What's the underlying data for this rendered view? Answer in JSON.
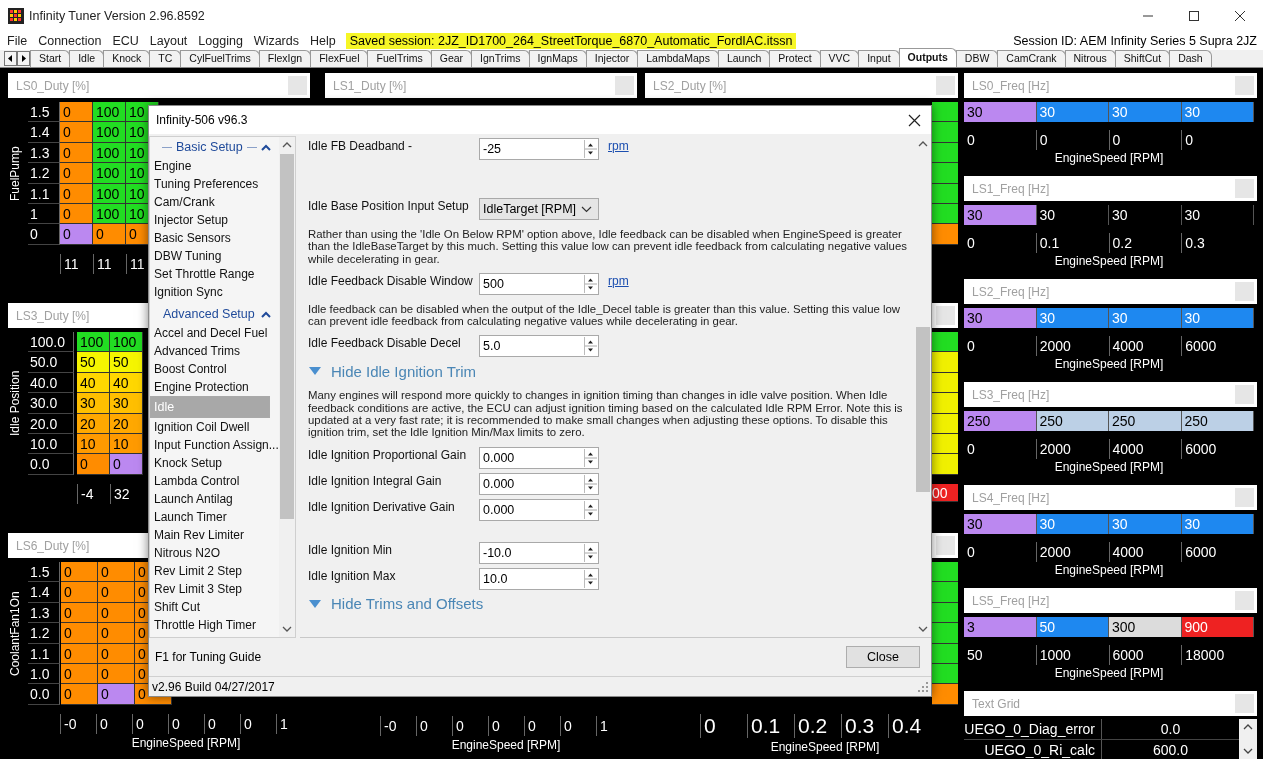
{
  "window": {
    "title": "Infinity Tuner Version 2.96.8592"
  },
  "menu": [
    "File",
    "Connection",
    "ECU",
    "Layout",
    "Logging",
    "Wizards",
    "Help"
  ],
  "saved_session": "Saved session: 2JZ_ID1700_264_StreetTorque_6870_Automatic_FordIAC.itssn",
  "session_id": "Session ID: AEM Infinity Series 5 Supra 2JZ",
  "tabs": [
    {
      "label": "Start",
      "selected": false
    },
    {
      "label": "Idle",
      "selected": false
    },
    {
      "label": "Knock",
      "selected": false
    },
    {
      "label": "TC",
      "selected": false
    },
    {
      "label": "CylFuelTrims",
      "selected": false
    },
    {
      "label": "FlexIgn",
      "selected": false
    },
    {
      "label": "FlexFuel",
      "selected": false
    },
    {
      "label": "FuelTrims",
      "selected": false
    },
    {
      "label": "Gear",
      "selected": false
    },
    {
      "label": "IgnTrims",
      "selected": false
    },
    {
      "label": "IgnMaps",
      "selected": false
    },
    {
      "label": "Injector",
      "selected": false
    },
    {
      "label": "LambdaMaps",
      "selected": false
    },
    {
      "label": "Launch",
      "selected": false
    },
    {
      "label": "Protect",
      "selected": false
    },
    {
      "label": "VVC",
      "selected": false
    },
    {
      "label": "Input",
      "selected": false
    },
    {
      "label": "Outputs",
      "selected": true
    },
    {
      "label": "DBW",
      "selected": false
    },
    {
      "label": "CamCrank",
      "selected": false
    },
    {
      "label": "Nitrous",
      "selected": false
    },
    {
      "label": "ShiftCut",
      "selected": false
    },
    {
      "label": "Dash",
      "selected": false
    }
  ],
  "left_panels": [
    {
      "title": "LS0_Duty [%]",
      "y_axis": "FuelPump",
      "rows": [
        {
          "label": "1.5",
          "cells": [
            {
              "text": "0",
              "color": "#ff8c00"
            },
            {
              "text": "100",
              "color": "#22dd22"
            },
            {
              "text": "10",
              "color": "#22dd22"
            }
          ]
        },
        {
          "label": "1.4",
          "cells": [
            {
              "text": "0",
              "color": "#ff8c00"
            },
            {
              "text": "100",
              "color": "#22dd22"
            },
            {
              "text": "10",
              "color": "#22dd22"
            }
          ]
        },
        {
          "label": "1.3",
          "cells": [
            {
              "text": "0",
              "color": "#ff8c00"
            },
            {
              "text": "100",
              "color": "#22dd22"
            },
            {
              "text": "10",
              "color": "#22dd22"
            }
          ]
        },
        {
          "label": "1.2",
          "cells": [
            {
              "text": "0",
              "color": "#ff8c00"
            },
            {
              "text": "100",
              "color": "#22dd22"
            },
            {
              "text": "10",
              "color": "#22dd22"
            }
          ]
        },
        {
          "label": "1.1",
          "cells": [
            {
              "text": "0",
              "color": "#ff8c00"
            },
            {
              "text": "100",
              "color": "#22dd22"
            },
            {
              "text": "10",
              "color": "#22dd22"
            }
          ]
        },
        {
          "label": "1",
          "cells": [
            {
              "text": "0",
              "color": "#ff8c00"
            },
            {
              "text": "100",
              "color": "#22dd22"
            },
            {
              "text": "10",
              "color": "#22dd22"
            }
          ]
        },
        {
          "label": "0",
          "cells": [
            {
              "text": "0",
              "color": "#bb88f0"
            },
            {
              "text": "0",
              "color": "#ff8c00"
            },
            {
              "text": "0",
              "color": "#ff8c00"
            }
          ]
        }
      ],
      "x_ticks": [
        "11",
        "11",
        "11"
      ]
    },
    {
      "title": "LS3_Duty [%]",
      "y_axis": "Idle Position",
      "rows": [
        {
          "label": "100.0",
          "cells": [
            {
              "text": "100",
              "color": "#22dd22"
            },
            {
              "text": "100",
              "color": "#22dd22"
            }
          ]
        },
        {
          "label": "50.0",
          "cells": [
            {
              "text": "50",
              "color": "#f5f500"
            },
            {
              "text": "50",
              "color": "#f5f500"
            }
          ]
        },
        {
          "label": "40.0",
          "cells": [
            {
              "text": "40",
              "color": "#ffd700"
            },
            {
              "text": "40",
              "color": "#ffd700"
            }
          ]
        },
        {
          "label": "30.0",
          "cells": [
            {
              "text": "30",
              "color": "#ffbf00"
            },
            {
              "text": "30",
              "color": "#ffbf00"
            }
          ]
        },
        {
          "label": "20.0",
          "cells": [
            {
              "text": "20",
              "color": "#ffa800"
            },
            {
              "text": "20",
              "color": "#ffa800"
            }
          ]
        },
        {
          "label": "10.0",
          "cells": [
            {
              "text": "10",
              "color": "#ff9a00"
            },
            {
              "text": "10",
              "color": "#ff9a00"
            }
          ]
        },
        {
          "label": "0.0",
          "cells": [
            {
              "text": "0",
              "color": "#ff8c00"
            },
            {
              "text": "0",
              "color": "#bb88f0"
            }
          ]
        }
      ],
      "x_ticks": [
        "-4",
        "32"
      ]
    },
    {
      "title": "LS6_Duty [%]",
      "y_axis": "CoolantFan1On",
      "rows": [
        {
          "label": "1.5",
          "cells": [
            {
              "text": "0",
              "color": "#ff8c00"
            },
            {
              "text": "0",
              "color": "#ff8c00"
            },
            {
              "text": "0",
              "color": "#ff8c00"
            }
          ]
        },
        {
          "label": "1.4",
          "cells": [
            {
              "text": "0",
              "color": "#ff8c00"
            },
            {
              "text": "0",
              "color": "#ff8c00"
            },
            {
              "text": "0",
              "color": "#ff8c00"
            }
          ]
        },
        {
          "label": "1.3",
          "cells": [
            {
              "text": "0",
              "color": "#ff8c00"
            },
            {
              "text": "0",
              "color": "#ff8c00"
            },
            {
              "text": "0",
              "color": "#ff8c00"
            }
          ]
        },
        {
          "label": "1.2",
          "cells": [
            {
              "text": "0",
              "color": "#ff8c00"
            },
            {
              "text": "0",
              "color": "#ff8c00"
            },
            {
              "text": "0",
              "color": "#ff8c00"
            }
          ]
        },
        {
          "label": "1.1",
          "cells": [
            {
              "text": "0",
              "color": "#ff8c00"
            },
            {
              "text": "0",
              "color": "#ff8c00"
            },
            {
              "text": "0",
              "color": "#ff8c00"
            }
          ]
        },
        {
          "label": "1.0",
          "cells": [
            {
              "text": "0",
              "color": "#ff8c00"
            },
            {
              "text": "0",
              "color": "#ff8c00"
            },
            {
              "text": "0",
              "color": "#ff8c00"
            }
          ]
        },
        {
          "label": "0.0",
          "cells": [
            {
              "text": "0",
              "color": "#ff8c00"
            },
            {
              "text": "0",
              "color": "#bb88f0"
            },
            {
              "text": "0",
              "color": "#ff8c00"
            }
          ]
        }
      ],
      "x_ticks": [
        "-0",
        "0",
        "0",
        "0",
        "0",
        "0",
        "1"
      ],
      "x_label": "EngineSpeed [RPM]"
    }
  ],
  "middle_column": {
    "title": "LS1_Duty [%]",
    "x_ticks": [
      "-0",
      "0",
      "0",
      "0",
      "0",
      "0",
      "1"
    ],
    "x_label": "EngineSpeed [RPM]"
  },
  "right_panels": [
    {
      "title": "LS2_Duty [%]",
      "cells": [
        {
          "color": "#22dd22"
        },
        {
          "color": "#22dd22"
        },
        {
          "color": "#22dd22"
        },
        {
          "color": "#22dd22"
        },
        {
          "color": "#22dd22"
        },
        {
          "color": "#22dd22"
        },
        {
          "color": "#ff8c00"
        }
      ]
    },
    {
      "cells": [
        {
          "color": "#22dd22"
        },
        {
          "color": "#f0f000"
        },
        {
          "color": "#f0f000"
        },
        {
          "color": "#f0f000"
        },
        {
          "color": "#f0f000"
        },
        {
          "color": "#f0f000"
        },
        {
          "color": "#f0f000"
        }
      ],
      "axis_cell": {
        "text": "00",
        "color": "#ee2222"
      }
    },
    {
      "cells": [
        {
          "color": "#22dd22"
        },
        {
          "color": "#22dd22"
        },
        {
          "color": "#22dd22"
        },
        {
          "color": "#22dd22"
        },
        {
          "color": "#22dd22"
        },
        {
          "color": "#22dd22"
        },
        {
          "color": "#ff8c00"
        }
      ],
      "x_ticks": [
        "0",
        "0.1",
        "0.2",
        "0.3",
        "0.4"
      ],
      "x_label": "EngineSpeed [RPM]"
    }
  ],
  "freq_panels": [
    {
      "title": "LS0_Freq [Hz]",
      "cells": [
        {
          "text": "30",
          "color": "#bb88f0"
        },
        {
          "text": "30",
          "color": "#1e88f0"
        },
        {
          "text": "30",
          "color": "#1e88f0"
        },
        {
          "text": "30",
          "color": "#1e88f0"
        }
      ],
      "x_ticks": [
        "0",
        "0",
        "0",
        "0"
      ],
      "x_label": "EngineSpeed [RPM]"
    },
    {
      "title": "LS1_Freq [Hz]",
      "cells": [
        {
          "text": "30",
          "color": "#bb88f0"
        },
        {
          "text": "30",
          "color": "#000000"
        },
        {
          "text": "30",
          "color": "#000000"
        },
        {
          "text": "30",
          "color": "#000000"
        }
      ],
      "x_ticks": [
        "0",
        "0.1",
        "0.2",
        "0.3"
      ],
      "x_label": "EngineSpeed [RPM]"
    },
    {
      "title": "LS2_Freq [Hz]",
      "cells": [
        {
          "text": "30",
          "color": "#bb88f0"
        },
        {
          "text": "30",
          "color": "#1e88f0"
        },
        {
          "text": "30",
          "color": "#1e88f0"
        },
        {
          "text": "30",
          "color": "#1e88f0"
        }
      ],
      "x_ticks": [
        "0",
        "2000",
        "4000",
        "6000"
      ],
      "x_label": "EngineSpeed [RPM]"
    },
    {
      "title": "LS3_Freq [Hz]",
      "cells": [
        {
          "text": "250",
          "color": "#bb88f0"
        },
        {
          "text": "250",
          "color": "#bcd0e6"
        },
        {
          "text": "250",
          "color": "#bcd0e6"
        },
        {
          "text": "250",
          "color": "#bcd0e6"
        }
      ],
      "x_ticks": [
        "0",
        "2000",
        "4000",
        "6000"
      ],
      "x_label": "EngineSpeed [RPM]"
    },
    {
      "title": "LS4_Freq [Hz]",
      "cells": [
        {
          "text": "30",
          "color": "#bb88f0"
        },
        {
          "text": "30",
          "color": "#1e88f0"
        },
        {
          "text": "30",
          "color": "#1e88f0"
        },
        {
          "text": "30",
          "color": "#1e88f0"
        }
      ],
      "x_ticks": [
        "0",
        "2000",
        "4000",
        "6000"
      ],
      "x_label": "EngineSpeed [RPM]"
    },
    {
      "title": "LS5_Freq [Hz]",
      "cells": [
        {
          "text": "3",
          "color": "#bb88f0"
        },
        {
          "text": "50",
          "color": "#1e88f0"
        },
        {
          "text": "300",
          "color": "#dcdcdc"
        },
        {
          "text": "900",
          "color": "#ee2222"
        }
      ],
      "x_ticks": [
        "50",
        "1000",
        "6000",
        "18000"
      ],
      "x_label": "EngineSpeed [RPM]"
    }
  ],
  "text_grid": {
    "title": "Text Grid",
    "rows": [
      {
        "name": "UEGO_0_Diag_error",
        "value": "0.0"
      },
      {
        "name": "UEGO_0_Ri_calc",
        "value": "600.0"
      }
    ]
  },
  "dialog": {
    "title": "Infinity-506 v96.3",
    "nav": [
      {
        "title": "Basic Setup",
        "expanded": true,
        "items": [
          {
            "label": "Engine",
            "selected": false
          },
          {
            "label": "Tuning Preferences",
            "selected": false
          },
          {
            "label": "Cam/Crank",
            "selected": false
          },
          {
            "label": "Injector Setup",
            "selected": false
          },
          {
            "label": "Basic Sensors",
            "selected": false
          },
          {
            "label": "DBW Tuning",
            "selected": false
          },
          {
            "label": "Set Throttle Range",
            "selected": false
          },
          {
            "label": "Ignition Sync",
            "selected": false
          }
        ]
      },
      {
        "title": "Advanced Setup",
        "expanded": true,
        "items": [
          {
            "label": "Accel and Decel Fuel",
            "selected": false
          },
          {
            "label": "Advanced Trims",
            "selected": false
          },
          {
            "label": "Boost Control",
            "selected": false
          },
          {
            "label": "Engine Protection",
            "selected": false
          },
          {
            "label": "Idle",
            "selected": true
          },
          {
            "label": "Ignition Coil Dwell",
            "selected": false
          },
          {
            "label": "Input Function Assign...",
            "selected": false
          },
          {
            "label": "Knock Setup",
            "selected": false
          },
          {
            "label": "Lambda Control",
            "selected": false
          },
          {
            "label": "Launch Antilag",
            "selected": false
          },
          {
            "label": "Launch Timer",
            "selected": false
          },
          {
            "label": "Main Rev Limiter",
            "selected": false
          },
          {
            "label": "Nitrous N2O",
            "selected": false
          },
          {
            "label": "Rev Limit 2 Step",
            "selected": false
          },
          {
            "label": "Rev Limit 3 Step",
            "selected": false
          },
          {
            "label": "Shift Cut",
            "selected": false
          },
          {
            "label": "Throttle High Timer",
            "selected": false
          }
        ]
      }
    ],
    "content": [
      {
        "kind": "number",
        "label": "Idle FB Deadband -",
        "value": "-25",
        "unit": "rpm"
      },
      {
        "kind": "spacer"
      },
      {
        "kind": "spacer"
      },
      {
        "kind": "select",
        "label": "Idle Base Position Input Setup",
        "value": "IdleTarget [RPM]"
      },
      {
        "kind": "text",
        "text": "Rather than using the 'Idle On Below RPM' option above, Idle feedback can be disabled when EngineSpeed is greater than the IdleBaseTarget by this much. Setting this value low can prevent idle feedback from calculating negative values while decelerating in gear."
      },
      {
        "kind": "number",
        "label": "Idle Feedback Disable Window",
        "value": "500",
        "unit": "rpm"
      },
      {
        "kind": "text",
        "text": "Idle feedback can be disabled when the output of the Idle_Decel table is greater than this value. Setting this value low can prevent idle feedback from calculating negative values while decelerating in gear."
      },
      {
        "kind": "number",
        "label": "Idle Feedback Disable Decel",
        "value": "5.0"
      },
      {
        "kind": "section",
        "label": "Hide Idle Ignition Trim",
        "expanded": true
      },
      {
        "kind": "text",
        "text": "Many engines will respond more quickly to changes in ignition timing than changes in idle valve position. When Idle feedback conditions are active, the ECU can adjust ignition timing based on the calculated Idle RPM Error. Note this is updated at a very fast rate; it is recommended to make small changes when adjusting these options. To disable this ignition trim, set the Idle Ignition Min/Max limits to zero."
      },
      {
        "kind": "number",
        "label": "Idle Ignition Proportional Gain",
        "value": "0.000"
      },
      {
        "kind": "number",
        "label": "Idle Ignition Integral Gain",
        "value": "0.000"
      },
      {
        "kind": "number",
        "label": "Idle Ignition Derivative Gain",
        "value": "0.000"
      },
      {
        "kind": "spacer"
      },
      {
        "kind": "number",
        "label": "Idle Ignition Min",
        "value": "-10.0"
      },
      {
        "kind": "number",
        "label": "Idle Ignition Max",
        "value": "10.0"
      },
      {
        "kind": "section",
        "label": "Hide Trims and Offsets",
        "expanded": true
      }
    ],
    "hint": "F1 for Tuning Guide",
    "close_button": "Close",
    "build": "v2.96 Build 04/27/2017"
  }
}
